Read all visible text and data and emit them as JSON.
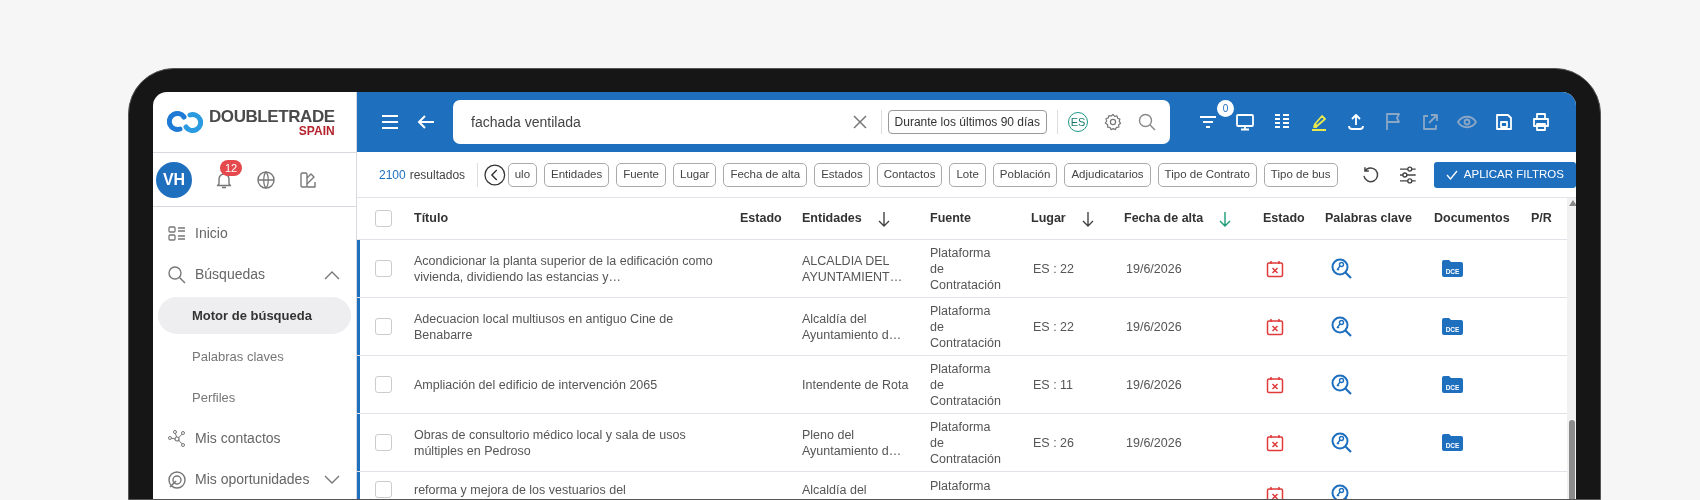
{
  "sidebar": {
    "logo": {
      "name": "DOUBLETRADE",
      "region": "SPAIN"
    },
    "user": {
      "initials": "VH"
    },
    "notifications": {
      "count": "12"
    },
    "items": [
      {
        "label": "Inicio",
        "selected": false
      },
      {
        "label": "Búsquedas",
        "selected": false,
        "expanded": true,
        "children": [
          {
            "label": "Motor de búsqueda",
            "selected": true
          },
          {
            "label": "Palabras claves",
            "selected": false
          },
          {
            "label": "Perfiles",
            "selected": false
          }
        ]
      },
      {
        "label": "Mis contactos",
        "selected": false
      },
      {
        "label": "Mis oportunidades",
        "selected": false,
        "expanded": false
      }
    ]
  },
  "search": {
    "value": "fachada ventilada",
    "date_range": "Durante los últimos 90 días",
    "language": "ES"
  },
  "toolbar": [
    {
      "kind": "filter",
      "badge": "0",
      "disabled": false
    },
    {
      "kind": "monitor",
      "disabled": false
    },
    {
      "kind": "columns",
      "disabled": false
    },
    {
      "kind": "highlighter",
      "disabled": false
    },
    {
      "kind": "upload",
      "disabled": false
    },
    {
      "kind": "flag",
      "disabled": true
    },
    {
      "kind": "share",
      "disabled": true
    },
    {
      "kind": "eye",
      "disabled": true
    },
    {
      "kind": "save",
      "disabled": false
    },
    {
      "kind": "print",
      "disabled": false
    }
  ],
  "results": {
    "count": "2100",
    "label": "resultados"
  },
  "filter_chips": [
    "ulo",
    "Entidades",
    "Fuente",
    "Lugar",
    "Fecha de alta",
    "Estados",
    "Contactos",
    "Lote",
    "Población",
    "Adjudicatarios",
    "Tipo de Contrato",
    "Tipo de bus"
  ],
  "apply_button": "APLICAR FILTROS",
  "table": {
    "select_all": {
      "checked": false
    },
    "columns": [
      {
        "label": "Título",
        "sortable": false
      },
      {
        "label": "Estado",
        "sortable": false
      },
      {
        "label": "Entidades",
        "sortable": true,
        "sort_active": false
      },
      {
        "label": "Fuente",
        "sortable": false
      },
      {
        "label": "Lugar",
        "sortable": true,
        "sort_active": false
      },
      {
        "label": "Fecha de alta",
        "sortable": true,
        "sort_active": true
      },
      {
        "label": "Estado",
        "sortable": false
      },
      {
        "label": "Palabras clave",
        "sortable": false
      },
      {
        "label": "Documentos",
        "sortable": false
      },
      {
        "label": "P/R",
        "sortable": false
      }
    ],
    "rows": [
      {
        "checked": false,
        "marked": true,
        "title": "Acondicionar la planta superior de la edificación como vivienda, dividiendo las estancias y…",
        "entity": "ALCALDIA DEL AYUNTAMIENT…",
        "source": "Plataforma de Contratación",
        "place": "ES : 22",
        "date": "19/6/2026",
        "document": "DCE"
      },
      {
        "checked": false,
        "marked": true,
        "title": "Adecuacion local multiusos en antiguo Cine de Benabarre",
        "entity": "Alcaldía del Ayuntamiento d…",
        "source": "Plataforma de Contratación",
        "place": "ES : 22",
        "date": "19/6/2026",
        "document": "DCE"
      },
      {
        "checked": false,
        "marked": true,
        "title": "Ampliación del edificio de intervención 2065",
        "entity": "Intendente de Rota",
        "source": "Plataforma de Contratación",
        "place": "ES : 11",
        "date": "19/6/2026",
        "document": "DCE"
      },
      {
        "checked": false,
        "marked": true,
        "title": "Obras de consultorio médico local y sala de usos múltiples en Pedroso",
        "entity": "Pleno del Ayuntamiento d…",
        "source": "Plataforma de Contratación",
        "place": "ES : 26",
        "date": "19/6/2026",
        "document": "DCE"
      },
      {
        "checked": false,
        "marked": true,
        "title": "reforma y mejora de los vestuarios del",
        "entity": "Alcaldía del",
        "source": "Plataforma"
      }
    ]
  }
}
